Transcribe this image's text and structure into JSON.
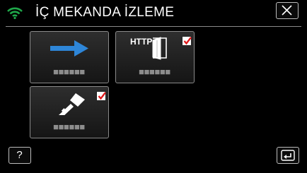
{
  "header": {
    "title": "İÇ MEKANDA İZLEME",
    "wifi_icon": "wifi-icon",
    "close_icon": "close-icon",
    "accent_color": "#1fa84a"
  },
  "tiles": [
    {
      "icon": "arrow-right-icon",
      "label": "■■■■■■",
      "checked": false
    },
    {
      "icon": "http-door-icon",
      "icon_text": "HTTP",
      "label": "■■■■■■",
      "checked": true
    },
    {
      "icon": "key-icon",
      "label": "■■■■■■",
      "checked": true
    }
  ],
  "footer": {
    "help_label": "?",
    "back_icon": "return-icon"
  },
  "colors": {
    "check": "#e0191b",
    "arrow": "#2e86d8"
  }
}
